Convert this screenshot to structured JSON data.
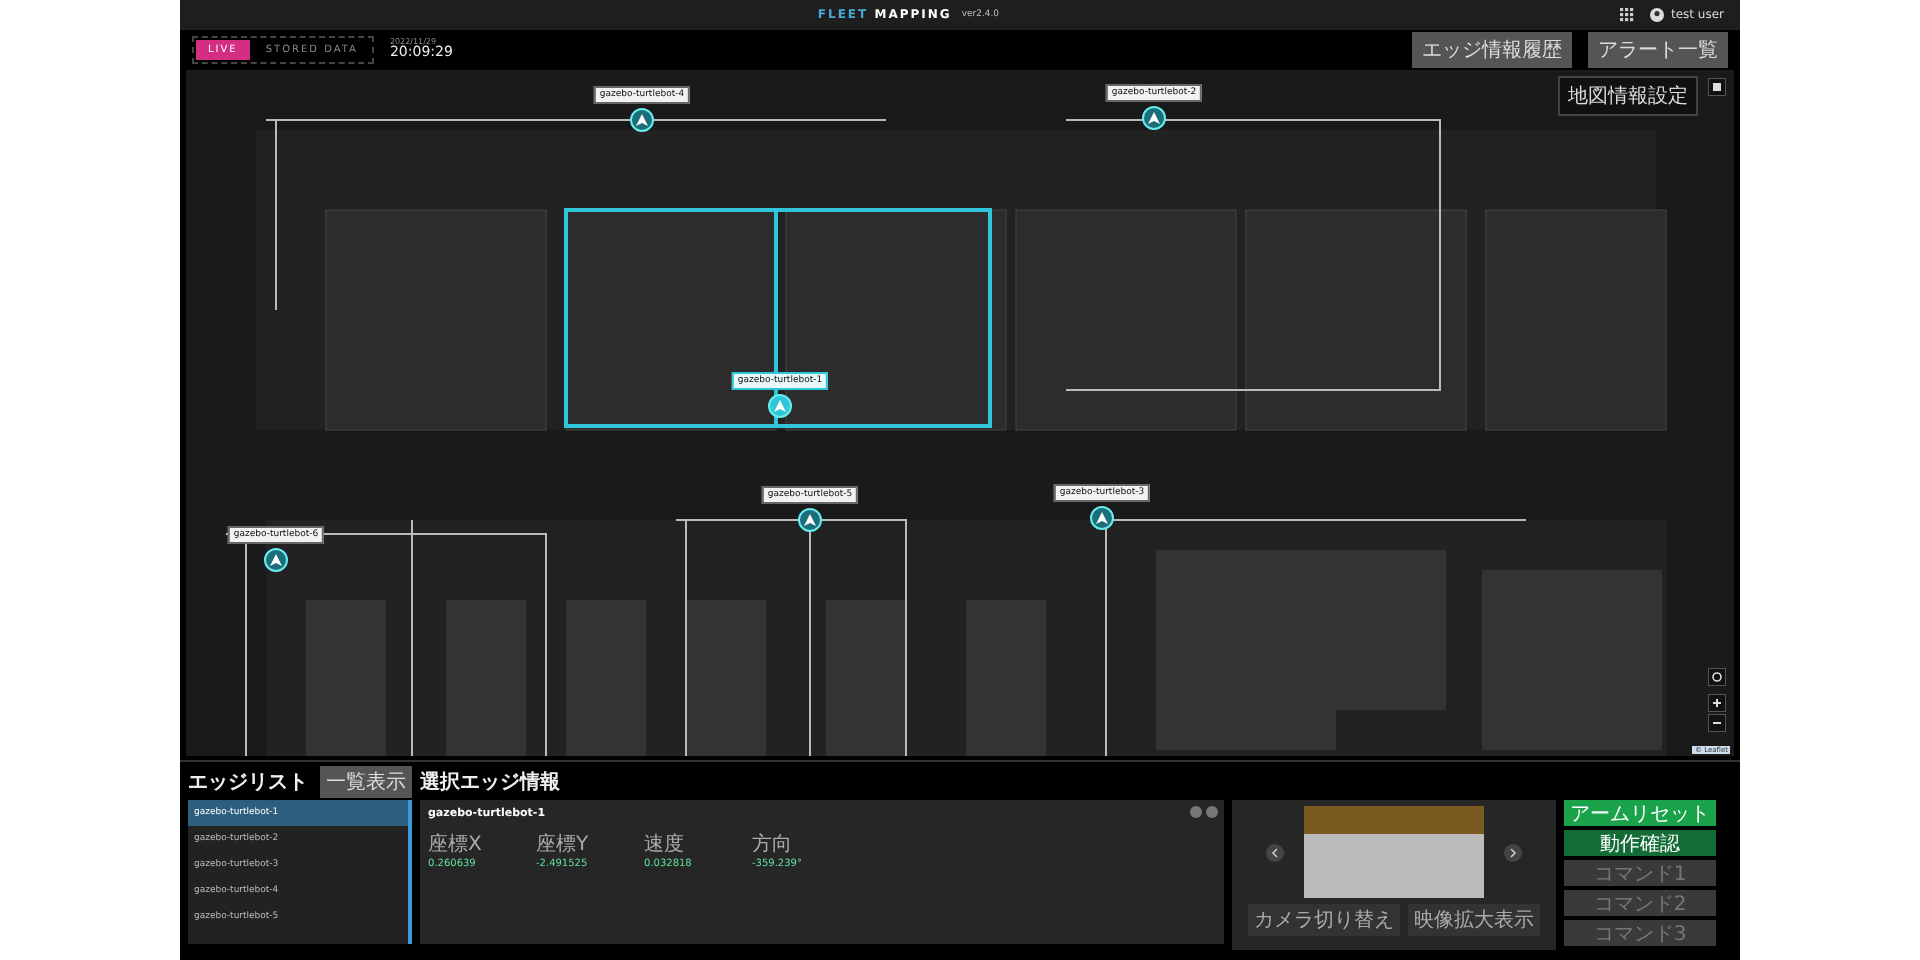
{
  "header": {
    "title_accent": "FLEET",
    "title": "MAPPING",
    "version": "ver2.4.0",
    "user": "test user"
  },
  "mode_tabs": [
    {
      "label": "LIVE",
      "selected": true
    },
    {
      "label": "STORED DATA",
      "selected": false
    }
  ],
  "clock": {
    "date": "2022/11/29",
    "time": "20:09:29"
  },
  "top_actions": [
    "エッジ情報履歴",
    "アラート一覧"
  ],
  "map": {
    "settings_button": "地図情報設定",
    "attribution": "© Leaflet",
    "robots": [
      {
        "name": "gazebo-turtlebot-4",
        "selected": false
      },
      {
        "name": "gazebo-turtlebot-2",
        "selected": false
      },
      {
        "name": "gazebo-turtlebot-1",
        "selected": true
      },
      {
        "name": "gazebo-turtlebot-5",
        "selected": false
      },
      {
        "name": "gazebo-turtlebot-3",
        "selected": false
      },
      {
        "name": "gazebo-turtlebot-6",
        "selected": false
      }
    ]
  },
  "edge_list": {
    "title": "エッジリスト",
    "list_button": "一覧表示",
    "items": [
      {
        "name": "gazebo-turtlebot-1",
        "selected": true
      },
      {
        "name": "gazebo-turtlebot-2",
        "selected": false
      },
      {
        "name": "gazebo-turtlebot-3",
        "selected": false
      },
      {
        "name": "gazebo-turtlebot-4",
        "selected": false
      },
      {
        "name": "gazebo-turtlebot-5",
        "selected": false
      }
    ]
  },
  "edge_info": {
    "title": "選択エッジ情報",
    "name": "gazebo-turtlebot-1",
    "fields": [
      {
        "label": "座標X",
        "value": "0.260639"
      },
      {
        "label": "座標Y",
        "value": "-2.491525"
      },
      {
        "label": "速度",
        "value": "0.032818"
      },
      {
        "label": "方向",
        "value": "-359.239°"
      }
    ]
  },
  "camera": {
    "buttons": [
      "カメラ切り替え",
      "映像拡大表示"
    ]
  },
  "commands": [
    {
      "label": "アームリセット",
      "disabled": false,
      "kind": "primary"
    },
    {
      "label": "動作確認",
      "disabled": false,
      "kind": "secondary"
    },
    {
      "label": "コマンド1",
      "disabled": true,
      "kind": "plain"
    },
    {
      "label": "コマンド2",
      "disabled": true,
      "kind": "plain"
    },
    {
      "label": "コマンド3",
      "disabled": true,
      "kind": "plain"
    }
  ]
}
